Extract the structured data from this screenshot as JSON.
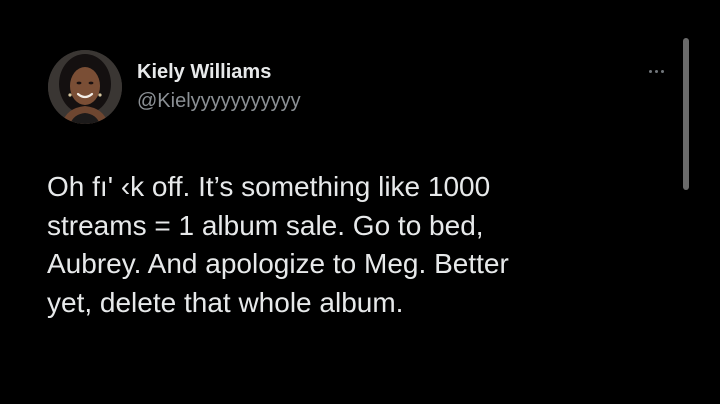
{
  "tweet": {
    "author_name": "Kiely Williams",
    "author_handle": "@Kielyyyyyyyyyyy",
    "more_icon": "more-horizontal-icon",
    "lines": [
      "Oh fı' ‹k off. It’s something like 1000",
      "streams = 1 album sale. Go to bed,",
      "Aubrey. And apologize to Meg. Better",
      "yet, delete that whole album."
    ]
  },
  "colors": {
    "background": "#000000",
    "primary_text": "#e7e9ea",
    "secondary_text": "#8b9095",
    "scrollbar": "#6b6b6b"
  }
}
